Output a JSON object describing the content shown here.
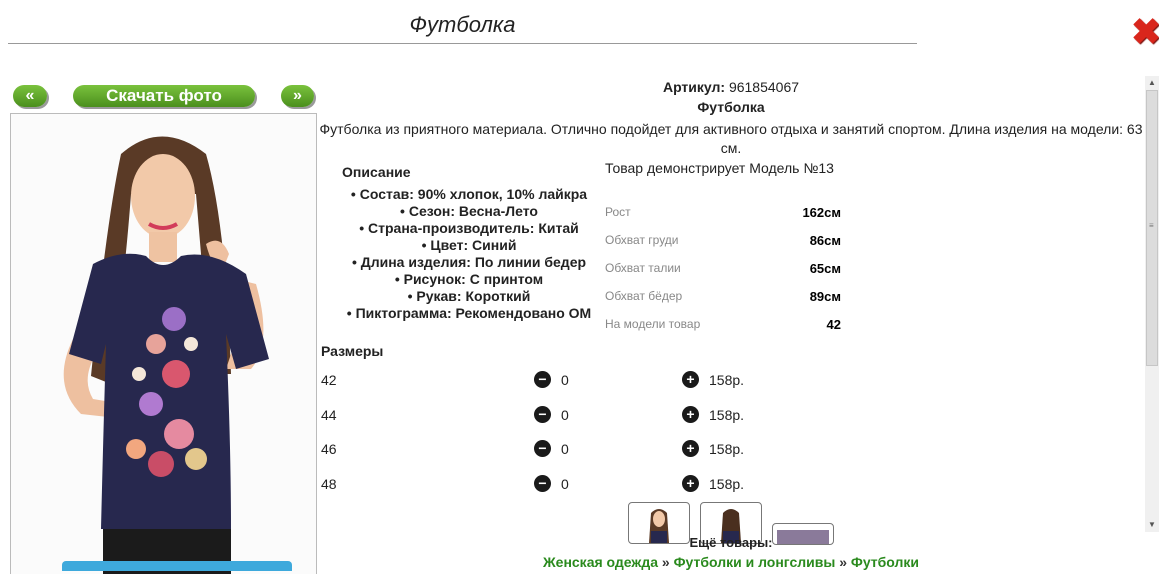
{
  "title": "Футболка",
  "nav": {
    "prev_label": "«",
    "download_label": "Скачать фото",
    "next_label": "»"
  },
  "product": {
    "article_label": "Артикул:",
    "article_value": "961854067",
    "name": "Футболка",
    "description": "Футболка из приятного материала. Отлично подойдет для активного отдыха и занятий спортом. Длина изделия на модели: 63 см."
  },
  "description_section": {
    "title": "Описание",
    "items": [
      "Состав: 90% хлопок, 10% лайкра",
      "Сезон: Весна-Лето",
      "Страна-производитель: Китай",
      "Цвет: Синий",
      "Длина изделия: По линии бедер",
      "Рисунок: С принтом",
      "Рукав: Короткий",
      "Пиктограмма: Рекомендовано ОМ"
    ]
  },
  "model": {
    "title": "Товар демонстрирует Модель №13",
    "rows": [
      {
        "label": "Рост",
        "value": "162см"
      },
      {
        "label": "Обхват груди",
        "value": "86см"
      },
      {
        "label": "Обхват талии",
        "value": "65см"
      },
      {
        "label": "Обхват бёдер",
        "value": "89см"
      },
      {
        "label": "На модели товар",
        "value": "42"
      }
    ]
  },
  "sizes": {
    "title": "Размеры",
    "rows": [
      {
        "size": "42",
        "qty": "0",
        "price": "158р."
      },
      {
        "size": "44",
        "qty": "0",
        "price": "158р."
      },
      {
        "size": "46",
        "qty": "0",
        "price": "158р."
      },
      {
        "size": "48",
        "qty": "0",
        "price": "158р."
      }
    ]
  },
  "more_label": "Ещё товары:",
  "breadcrumbs": [
    "Женская одежда",
    "Футболки и лонгсливы",
    "Футболки"
  ],
  "icons": {
    "close": "close-icon",
    "minus": "minus-icon",
    "plus": "plus-icon"
  },
  "colors": {
    "button_green": "#5ea62a",
    "link_green": "#2a8a1d",
    "close_red": "#d9261c",
    "shirt_navy": "#27284e"
  }
}
